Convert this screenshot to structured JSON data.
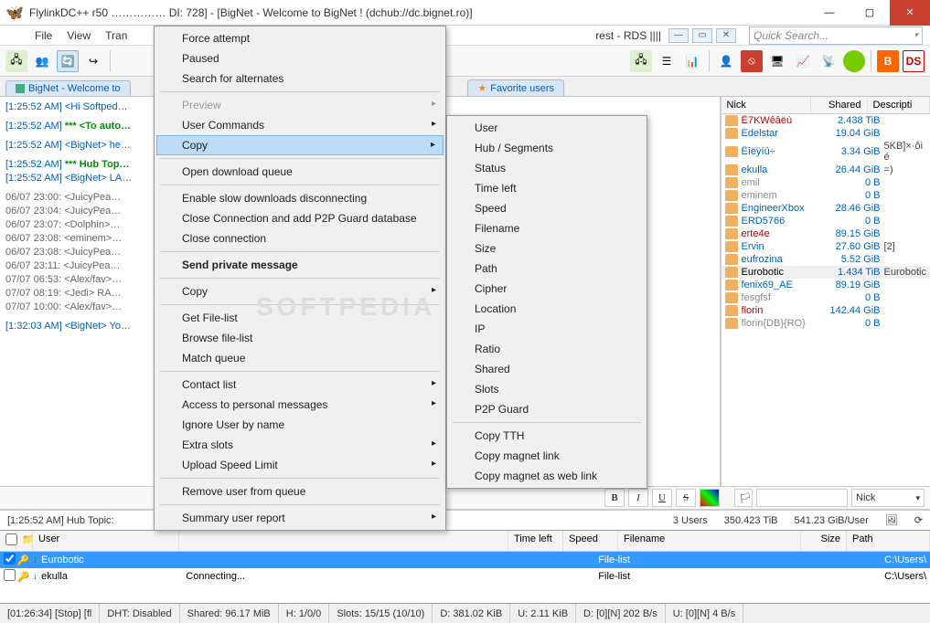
{
  "titlebar": {
    "title": "FlylinkDC++ r50 …………… DI: 728] - [BigNet - Welcome to BigNet ! (dchub://dc.bignet.ro)]"
  },
  "winbtns": {
    "min": "—",
    "max": "▢",
    "close": "✕"
  },
  "menubar": {
    "file": "File",
    "view": "View",
    "tran": "Tran",
    "mdi_title": "rest - RDS ||||"
  },
  "search": {
    "placeholder": "Quick Search..."
  },
  "tabs": {
    "bignet": "BigNet - Welcome to",
    "favusers": "Favorite users"
  },
  "chat": {
    "l1": "[1:25:52 AM] <Hi Softped…",
    "l2_ts": "[1:25:52 AM] ",
    "l2_txt": "*** <To auto…",
    "l3": "[1:25:52 AM] <BigNet> he…",
    "l4_ts": "[1:25:52 AM] ",
    "l4_txt": "*** Hub Top…",
    "l5": "[1:25:52 AM] <BigNet> LA…",
    "l6": "06/07 23:00: <JuicyPea…",
    "l7": "06/07 23:04: <JuicyPea…",
    "l8": "06/07 23:07: <Dolphin>…",
    "l9": "06/07 23:08: <eminem>…",
    "l10": "06/07 23:08: <JuicyPea…",
    "l11": "06/07 23:11: <JuicyPea…",
    "l12": "07/07 06:53: <Alex/fav>…",
    "l13": "07/07 08:19: <Jedi> RA…",
    "l14": "07/07 10:00: <Alex/fav>…",
    "l15": "[1:32:03 AM] <BigNet> Yo…"
  },
  "hubtopic": "[1:25:52 AM] Hub Topic: ",
  "nickheader": {
    "nick": "Nick",
    "shared": "Shared",
    "desc": "Descripti"
  },
  "nicks": [
    {
      "n": "Ê7KWêâëù",
      "s": "2.438 TiB",
      "d": "",
      "cls": "red"
    },
    {
      "n": "Edelstar",
      "s": "19.04 GiB",
      "d": "",
      "cls": "blue"
    },
    {
      "n": "Êîëÿíû÷",
      "s": "3.34 GiB",
      "d": "5KB]×·ôi é",
      "cls": "blue"
    },
    {
      "n": "ekulla",
      "s": "26.44 GiB",
      "d": "=)",
      "cls": "blue"
    },
    {
      "n": "emil",
      "s": "0 B",
      "d": "",
      "cls": "grey"
    },
    {
      "n": "eminem",
      "s": "0 B",
      "d": "",
      "cls": "grey"
    },
    {
      "n": "EngineerXbox",
      "s": "28.46 GiB",
      "d": "",
      "cls": "blue"
    },
    {
      "n": "ERD5766",
      "s": "0 B",
      "d": "",
      "cls": "blue"
    },
    {
      "n": "erte4e",
      "s": "89.15 GiB",
      "d": "",
      "cls": "red"
    },
    {
      "n": "Ervin",
      "s": "27.60 GiB",
      "d": "[2]",
      "cls": "blue"
    },
    {
      "n": "eufrozina",
      "s": "5.52 GiB",
      "d": "",
      "cls": "blue"
    },
    {
      "n": "Eurobotic",
      "s": "1.434 TiB",
      "d": "Eurobotic",
      "cls": "",
      "sel": true
    },
    {
      "n": "fenix69_AE",
      "s": "89.19 GiB",
      "d": "",
      "cls": "blue"
    },
    {
      "n": "fesgfsf",
      "s": "0 B",
      "d": "",
      "cls": "grey"
    },
    {
      "n": "florin",
      "s": "142.44 GiB",
      "d": "",
      "cls": "red"
    },
    {
      "n": "florin{DB}{RO}",
      "s": "0 B",
      "d": "",
      "cls": "grey"
    }
  ],
  "stats": {
    "users": "3 Users",
    "total": "350.423 TiB",
    "peruser": "541.23 GiB/User"
  },
  "fmt": {
    "nick": "Nick"
  },
  "dlheader": {
    "cb": "",
    "user": "User",
    "timeleft": "Time left",
    "speed": "Speed",
    "filename": "Filename",
    "size": "Size",
    "path": "Path"
  },
  "dlrows": [
    {
      "u": "Eurobotic",
      "st": "",
      "fn": "File-list",
      "sz": "",
      "pa": "C:\\Users\\",
      "sel": true,
      "arrow": "↓",
      "col": "#1c8a1c"
    },
    {
      "u": "ekulla",
      "st": "Connecting...",
      "fn": "File-list",
      "sz": "",
      "pa": "C:\\Users\\",
      "sel": false,
      "arrow": "↓",
      "col": "#1c8a1c"
    }
  ],
  "statusbar": {
    "s1": "[01:26:34] [Stop] [fl",
    "s2": "DHT: Disabled",
    "s3": "Shared: 96.17 MiB",
    "s4": "H: 1/0/0",
    "s5": "Slots: 15/15 (10/10)",
    "s6": "D: 381.02 KiB",
    "s7": "U: 2.11 KiB",
    "s8": "D: [0][N] 202 B/s",
    "s9": "U: [0][N] 4 B/s"
  },
  "menu1": [
    {
      "t": "Force attempt"
    },
    {
      "t": "Paused"
    },
    {
      "t": "Search for alternates"
    },
    {
      "sep": true
    },
    {
      "t": "Preview",
      "arrow": true,
      "disabled": true
    },
    {
      "t": "User Commands",
      "arrow": true
    },
    {
      "t": "Copy",
      "arrow": true,
      "hi": true
    },
    {
      "sep": true
    },
    {
      "t": "Open download queue"
    },
    {
      "sep": true
    },
    {
      "t": "Enable slow downloads disconnecting"
    },
    {
      "t": "Close Connection and add P2P Guard database"
    },
    {
      "t": "Close connection"
    },
    {
      "sep": true
    },
    {
      "t": "Send private message",
      "bold": true
    },
    {
      "sep": true
    },
    {
      "t": "Copy",
      "arrow": true
    },
    {
      "sep": true
    },
    {
      "t": "Get File-list"
    },
    {
      "t": "Browse file-list"
    },
    {
      "t": "Match queue"
    },
    {
      "sep": true
    },
    {
      "t": "Contact list",
      "arrow": true
    },
    {
      "t": "Access to personal messages",
      "arrow": true
    },
    {
      "t": "Ignore User by name"
    },
    {
      "t": "Extra slots",
      "arrow": true
    },
    {
      "t": "Upload Speed Limit",
      "arrow": true
    },
    {
      "sep": true
    },
    {
      "t": "Remove user from queue"
    },
    {
      "sep": true
    },
    {
      "t": "Summary user report",
      "arrow": true
    }
  ],
  "menu2": [
    {
      "t": "User"
    },
    {
      "t": "Hub / Segments"
    },
    {
      "t": "Status"
    },
    {
      "t": "Time left"
    },
    {
      "t": "Speed"
    },
    {
      "t": "Filename"
    },
    {
      "t": "Size"
    },
    {
      "t": "Path"
    },
    {
      "t": "Cipher"
    },
    {
      "t": "Location"
    },
    {
      "t": "IP"
    },
    {
      "t": "Ratio"
    },
    {
      "t": "Shared"
    },
    {
      "t": "Slots"
    },
    {
      "t": "P2P Guard"
    },
    {
      "sep": true
    },
    {
      "t": "Copy TTH"
    },
    {
      "t": "Copy magnet link"
    },
    {
      "t": "Copy magnet as web link"
    }
  ],
  "watermark": "SOFTPEDIA"
}
